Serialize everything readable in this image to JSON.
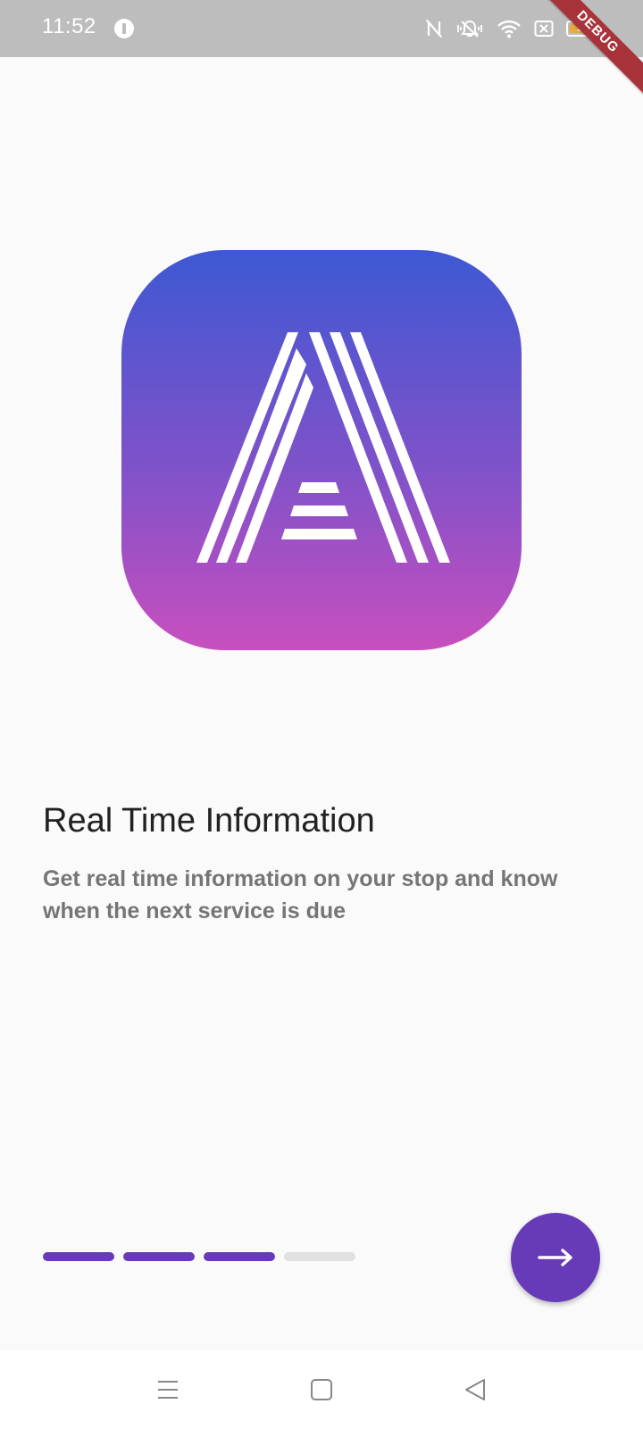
{
  "status_bar": {
    "time": "11:52",
    "battery_level": "94",
    "icons": [
      "app-notification-icon",
      "nfc-off-icon",
      "vibrate-icon",
      "wifi-icon",
      "sim-off-icon",
      "battery-icon"
    ]
  },
  "debug_banner": {
    "label": "DEBUG"
  },
  "logo": {
    "icon": "app-logo-letter-a",
    "gradient_top": "#3e58d3",
    "gradient_bottom": "#c84fbe"
  },
  "content": {
    "title": "Real Time Information",
    "subtitle": "Get real time information on your stop and know when the next service is due"
  },
  "pager": {
    "total_pages": 4,
    "current_page": 3
  },
  "next_button": {
    "icon": "arrow-right-icon",
    "color": "#673ab7"
  },
  "nav_bar": {
    "icons": [
      "menu-icon",
      "home-square-icon",
      "back-triangle-icon"
    ]
  }
}
